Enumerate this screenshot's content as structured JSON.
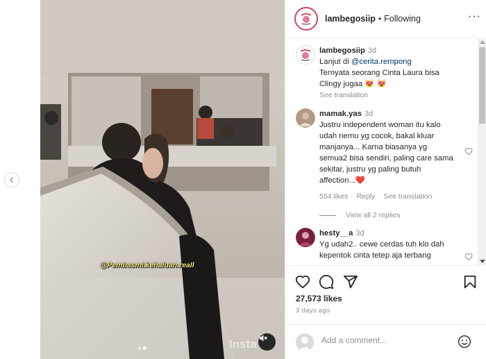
{
  "post": {
    "username": "lambegosiip",
    "separator": "•",
    "follow_status": "Following",
    "watermark": "@Pembasmi.kehaluan.reall",
    "platform_mark": "Insta",
    "likes": "27,573 likes",
    "date": "3 days ago",
    "add_comment_placeholder": "Add a comment...",
    "more_icon": "more-icon"
  },
  "caption": {
    "username": "lambegosiip",
    "time": "3d",
    "text_prefix": "Lanjut di ",
    "mention": "@cerita.rempong",
    "text_rest": "Ternyata seorang Cinta Laura bisa Clingy jugaa 😻 😻",
    "see_translation": "See translation"
  },
  "comments": [
    {
      "username": "mamak.yas",
      "time": "3d",
      "text": "Justru independent woman itu kalo udah nemu yg cocok, bakal kluar manjanya... Karna biasanya yg semua2 bisa sendiri, paling care sama sekitar, justru yg paling butuh affection...❤️",
      "likes": "554 likes",
      "reply": "Reply",
      "see_translation": "See translation",
      "view_replies": "View all 2 replies"
    },
    {
      "username": "hesty__a",
      "time": "3d",
      "text": "Yg udah2.. cewe cerdas tuh klo dah kepentok cinta tetep aja terbang"
    }
  ],
  "colors": {
    "accent_ring": "#d63e6c",
    "link": "#00376b",
    "muted": "#8e8e8e",
    "heart_red": "#e0245e"
  }
}
